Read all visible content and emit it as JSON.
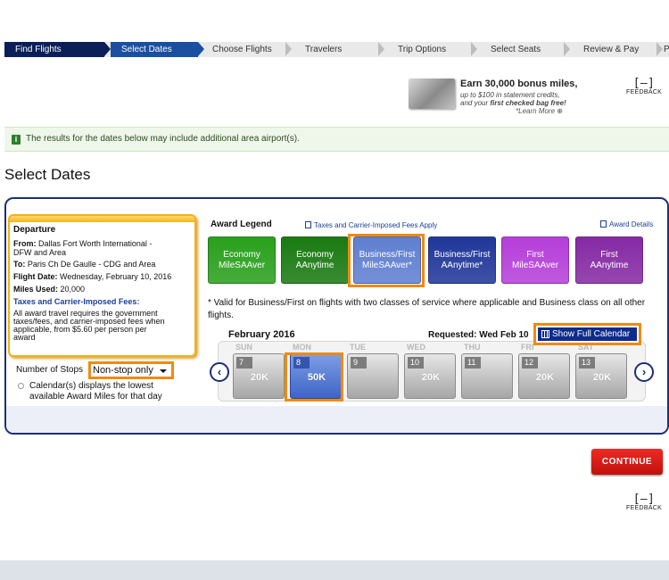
{
  "steps": [
    {
      "label": "Find Flights",
      "state": "done"
    },
    {
      "label": "Select Dates",
      "state": "active"
    },
    {
      "label": "Choose Flights",
      "state": "todo"
    },
    {
      "label": "Travelers",
      "state": "todo"
    },
    {
      "label": "Trip Options",
      "state": "todo"
    },
    {
      "label": "Select Seats",
      "state": "todo"
    },
    {
      "label": "Review & Pay",
      "state": "todo"
    },
    {
      "label": "P",
      "state": "todo"
    }
  ],
  "promo": {
    "title": "Earn 30,000 bonus miles,",
    "line1": "up to $100 in statement credits,",
    "line2_prefix": "and your ",
    "line2_bold": "first checked bag free!",
    "learn_more": "*Learn More ⊕"
  },
  "feedback": {
    "icon": "[–]",
    "label": "FEEDBACK"
  },
  "notice": {
    "icon": "info-icon",
    "text": "The results for the dates below may include additional area airport(s)."
  },
  "page_title": "Select Dates",
  "departure": {
    "heading": "Departure",
    "from_label": "From:",
    "from_value": "Dallas Fort Worth International -",
    "from_value2": "DFW and Area",
    "to_label": "To:",
    "to_value": "Paris Ch De Gaulle - CDG and Area",
    "date_label": "Flight Date:",
    "date_value": "Wednesday, February 10, 2016",
    "miles_label": "Miles Used:",
    "miles_value": "20,000",
    "fees_heading": "Taxes and Carrier-Imposed Fees:",
    "fees_text1": "All award travel requires the government",
    "fees_text2": "taxes/fees, and carrier-imposed fees when",
    "fees_text3": "applicable, from $5.60 per person per",
    "fees_text4": "award"
  },
  "stops": {
    "label": "Number of Stops",
    "selected": "Non-stop only",
    "calendar_note1": "Calendar(s) displays the lowest",
    "calendar_note2": "available Award Miles for that day"
  },
  "legend": {
    "title": "Award Legend",
    "fees_link": "Taxes and Carrier-Imposed Fees Apply",
    "details_link": "Award Details",
    "items": [
      {
        "line1": "Economy",
        "line2": "MileSAAver",
        "color": "#2aa01d"
      },
      {
        "line1": "Economy",
        "line2": "AAnytime",
        "color": "#1a7a12"
      },
      {
        "line1": "Business/First",
        "line2": "MileSAAver*",
        "color": "#5f7fd0"
      },
      {
        "line1": "Business/First",
        "line2": "AAnytime*",
        "color": "#21379a"
      },
      {
        "line1": "First",
        "line2": "MileSAAver",
        "color": "#b53fd9"
      },
      {
        "line1": "First",
        "line2": "AAnytime",
        "color": "#862aa4"
      }
    ],
    "valid_note": "* Valid for Business/First on flights with two classes of service where applicable and Business class on all other flights."
  },
  "calendar": {
    "month": "February 2016",
    "requested": "Requested: Wed Feb 10",
    "full_calendar": "Show Full Calendar",
    "prev": "‹",
    "next": "›",
    "days": [
      {
        "dow": "SUN",
        "num": "7",
        "value": "20K",
        "selected": false
      },
      {
        "dow": "MON",
        "num": "8",
        "value": "50K",
        "selected": true
      },
      {
        "dow": "TUE",
        "num": "9",
        "value": "",
        "selected": false
      },
      {
        "dow": "WED",
        "num": "10",
        "value": "20K",
        "selected": false
      },
      {
        "dow": "THU",
        "num": "11",
        "value": "",
        "selected": false
      },
      {
        "dow": "FRI",
        "num": "12",
        "value": "20K",
        "selected": false
      },
      {
        "dow": "SAT",
        "num": "13",
        "value": "20K",
        "selected": false
      }
    ]
  },
  "continue_label": "CONTINUE"
}
